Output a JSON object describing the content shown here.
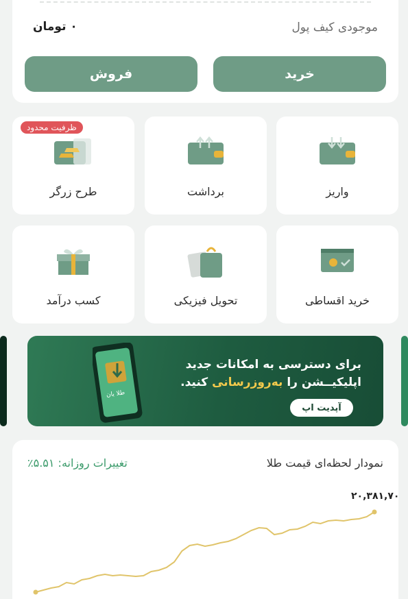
{
  "wallet": {
    "balance_label": "موجودی کیف پول",
    "balance_value": "۰ تومان",
    "buy_label": "خرید",
    "sell_label": "فروش"
  },
  "services": [
    {
      "label": "واریز",
      "icon": "deposit-wallet-icon"
    },
    {
      "label": "برداشت",
      "icon": "withdraw-wallet-icon"
    },
    {
      "label": "طرح زرگر",
      "icon": "gold-bars-icon",
      "badge": "ظرفیت محدود"
    },
    {
      "label": "خرید اقساطی",
      "icon": "installment-card-icon"
    },
    {
      "label": "تحویل فیزیکی",
      "icon": "shopping-bag-icon"
    },
    {
      "label": "کسب درآمد",
      "icon": "gift-box-icon"
    }
  ],
  "banner": {
    "line1": "برای دسترسی به امکانات جدید",
    "line2_prefix": "اپلیکیــشن را",
    "line2_highlight": "به‌روزرسانی",
    "line2_suffix": "کنید.",
    "button_label": "آپدیت اپ",
    "phone_text": "طلا بان"
  },
  "chart": {
    "title": "نمودار لحظه‌ای قیمت طلا",
    "daily_change": "تغییرات روزانه: ۵.۵۱٪",
    "last_price": "۲۰,۳۸۱,۷۰",
    "line_color": "#e0c46a",
    "accent_color": "#6f9c86"
  },
  "chart_data": {
    "type": "line",
    "title": "نمودار لحظه‌ای قیمت طلا",
    "xlabel": "",
    "ylabel": "",
    "values": [
      0,
      3,
      6,
      8,
      14,
      12,
      18,
      20,
      24,
      26,
      24,
      25,
      24,
      23,
      24,
      30,
      32,
      36,
      44,
      60,
      68,
      70,
      67,
      69,
      72,
      74,
      78,
      84,
      90,
      94,
      93,
      84,
      86,
      91,
      92,
      96,
      102,
      100,
      104,
      105,
      104,
      106,
      107,
      110,
      117
    ],
    "grid": false
  }
}
